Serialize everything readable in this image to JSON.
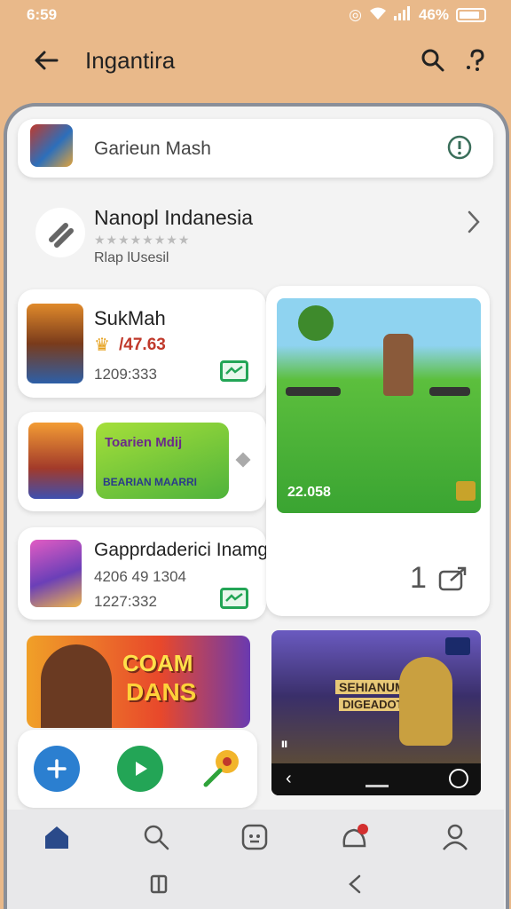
{
  "status": {
    "time": "6:59",
    "battery": "46%"
  },
  "appbar": {
    "title": "Ingantira"
  },
  "card1": {
    "title": "Garieun Mash"
  },
  "card2": {
    "title": "Nanopl Indanesia",
    "subtitle": "Rlap lUsesil"
  },
  "card3": {
    "title": "SukMah",
    "price": "/47.63",
    "meta": "1209:333"
  },
  "card4": {
    "banner": "Toarien Mdij",
    "banner_sub": "BEARIAN MAARRI"
  },
  "card5": {
    "title": "Gapprdaderici Inamgan",
    "line1": "4206 49 1304",
    "line2": "1227:332"
  },
  "preview": {
    "value": "22.058"
  },
  "preview_side": {
    "count": "1"
  },
  "promo": {
    "line1": "COAM",
    "line2": "DANS"
  },
  "game_preview": {
    "line1": "SEHIANUM",
    "line2": "DIGEADOT"
  },
  "colors": {
    "accent_green": "#23a556",
    "accent_blue": "#2b7fd0",
    "brand_bg": "#e9b98a"
  }
}
